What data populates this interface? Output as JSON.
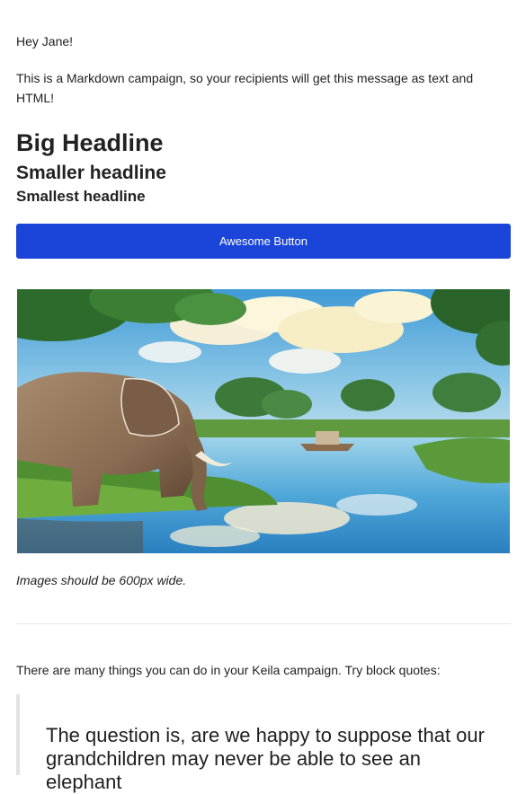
{
  "email": {
    "greeting": "Hey Jane!",
    "intro": "This is a Markdown campaign, so your recipients will get this message as text and HTML!",
    "headline_big": "Big Headline",
    "headline_smaller": "Smaller headline",
    "headline_smallest": "Smallest headline",
    "button_label": "Awesome Button",
    "image_caption": "Images should be 600px wide.",
    "body_text": "There are many things you can do in your Keila campaign. Try block quotes:",
    "quote_text": "The question is, are we happy to suppose that our grandchildren may never be able to see an elephant"
  },
  "colors": {
    "button_bg": "#1b45d8",
    "button_text": "#ffffff",
    "divider": "#e6e6e6",
    "quote_border": "#e3e3e3"
  }
}
